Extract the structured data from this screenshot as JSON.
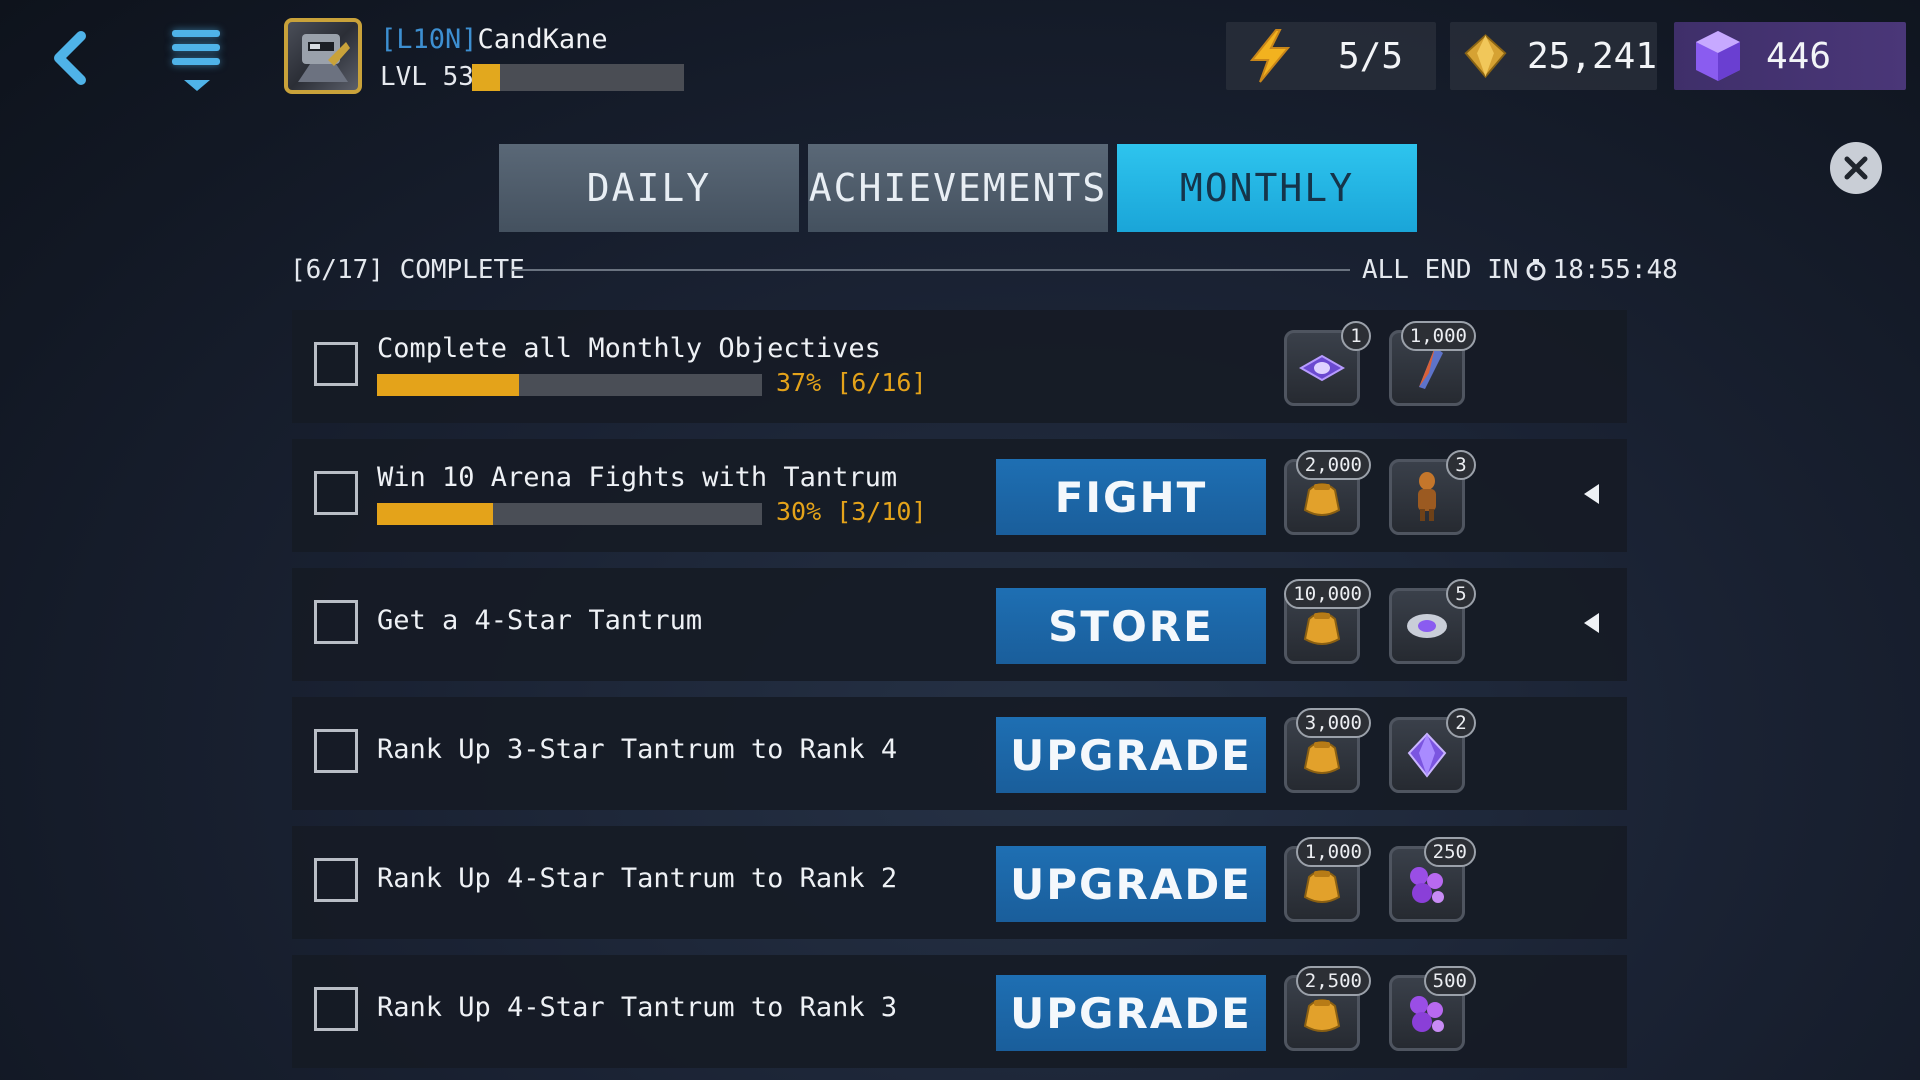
{
  "player": {
    "tag": "[L10N]",
    "name": "CandKane",
    "level_label": "LVL 53",
    "xp_fraction": 0.13
  },
  "resources": {
    "energy": "5/5",
    "gold": "25,241",
    "units": "446"
  },
  "tabs": [
    {
      "label": "DAILY",
      "active": false
    },
    {
      "label": "ACHIEVEMENTS",
      "active": false
    },
    {
      "label": "MONTHLY",
      "active": true
    }
  ],
  "summary": {
    "complete": "[6/17] COMPLETE",
    "ends_label": "ALL END IN",
    "ends_time": "18:55:48"
  },
  "colors": {
    "accent_tab": "#2ec4ee",
    "progress": "#e4a31a",
    "button": "#1e6fb3",
    "crystal": "#8a5cf0"
  },
  "objectives": [
    {
      "title": "Complete all Monthly Objectives",
      "progress": 0.37,
      "progress_text": "37% [6/16]",
      "action": "",
      "rewards": [
        {
          "icon": "purple-eye-shard-icon",
          "count": "1"
        },
        {
          "icon": "feather-shard-icon",
          "count": "1,000"
        }
      ]
    },
    {
      "title": "Win 10 Arena Fights with Tantrum",
      "progress": 0.3,
      "progress_text": "30% [3/10]",
      "action": "FIGHT",
      "rewards": [
        {
          "icon": "gold-bag-icon",
          "count": "2,000"
        },
        {
          "icon": "hero-figure-icon",
          "count": "3"
        }
      ]
    },
    {
      "title": "Get a 4-Star Tantrum",
      "progress": null,
      "progress_text": "",
      "action": "STORE",
      "rewards": [
        {
          "icon": "gold-bag-icon",
          "count": "10,000"
        },
        {
          "icon": "silver-orb-icon",
          "count": "5"
        }
      ]
    },
    {
      "title": "Rank Up 3-Star Tantrum to Rank 4",
      "progress": null,
      "progress_text": "",
      "action": "UPGRADE",
      "rewards": [
        {
          "icon": "gold-bag-icon",
          "count": "3,000"
        },
        {
          "icon": "purple-crystal-icon",
          "count": "2"
        }
      ]
    },
    {
      "title": "Rank Up 4-Star Tantrum to Rank 2",
      "progress": null,
      "progress_text": "",
      "action": "UPGRADE",
      "rewards": [
        {
          "icon": "gold-bag-icon",
          "count": "1,000"
        },
        {
          "icon": "purple-gems-icon",
          "count": "250"
        }
      ]
    },
    {
      "title": "Rank Up 4-Star Tantrum to Rank 3",
      "progress": null,
      "progress_text": "",
      "action": "UPGRADE",
      "rewards": [
        {
          "icon": "gold-bag-icon",
          "count": "2,500"
        },
        {
          "icon": "purple-gems-icon",
          "count": "500"
        }
      ]
    }
  ]
}
